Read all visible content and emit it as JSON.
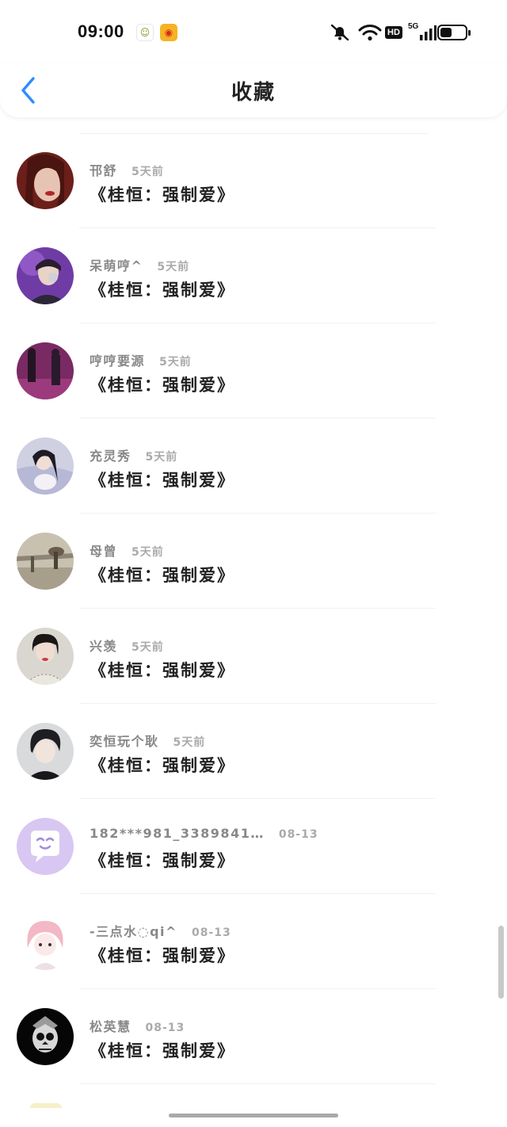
{
  "statusbar": {
    "time": "09:00",
    "icons": [
      "app-notification-icon",
      "weibo-icon",
      "mute-icon",
      "wifi-icon",
      "hd-icon",
      "5g-signal-icon",
      "battery-icon"
    ],
    "hd_label": "HD",
    "network_label": "5G",
    "battery_level": 0.45
  },
  "header": {
    "title": "收藏",
    "back_icon": "chevron-left-icon",
    "accent": "#2d8cff"
  },
  "list": {
    "items": [
      {
        "name": "邗舒",
        "time": "5天前",
        "title": "《桂恒：强制爱》"
      },
      {
        "name": "呆萌哼^",
        "time": "5天前",
        "title": "《桂恒：强制爱》"
      },
      {
        "name": "哼哼要源",
        "time": "5天前",
        "title": "《桂恒：强制爱》"
      },
      {
        "name": "充灵秀",
        "time": "5天前",
        "title": "《桂恒：强制爱》"
      },
      {
        "name": "母曾",
        "time": "5天前",
        "title": "《桂恒：强制爱》"
      },
      {
        "name": "兴羡",
        "time": "5天前",
        "title": "《桂恒：强制爱》"
      },
      {
        "name": "奕恒玩个耿",
        "time": "5天前",
        "title": "《桂恒：强制爱》"
      },
      {
        "name": "182***981_3389841…",
        "time": "08-13",
        "title": "《桂恒：强制爱》"
      },
      {
        "name": "-三点水◌qi^",
        "time": "08-13",
        "title": "《桂恒：强制爱》"
      },
      {
        "name": "松英慧",
        "time": "08-13",
        "title": "《桂恒：强制爱》"
      }
    ]
  }
}
